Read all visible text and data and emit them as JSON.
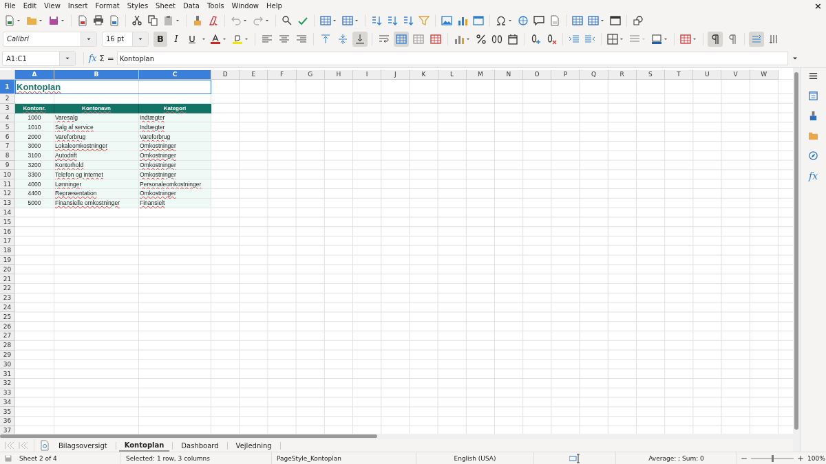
{
  "window": {
    "close": "×"
  },
  "menu": [
    "File",
    "Edit",
    "View",
    "Insert",
    "Format",
    "Styles",
    "Sheet",
    "Data",
    "Tools",
    "Window",
    "Help"
  ],
  "format_bar": {
    "font": "Calibri",
    "size": "16 pt",
    "text_style": [
      {
        "kind": "bold",
        "label": "B",
        "on": true
      },
      {
        "kind": "italic",
        "label": "I",
        "on": false
      },
      {
        "kind": "underline",
        "label": "U",
        "on": false
      }
    ],
    "horizontal_align": [
      {
        "kind": "left",
        "selected": false
      },
      {
        "kind": "center",
        "selected": false
      },
      {
        "kind": "right",
        "selected": false
      }
    ],
    "vertical_align": [
      {
        "kind": "top",
        "selected": false
      },
      {
        "kind": "middle",
        "selected": false
      },
      {
        "kind": "bottom",
        "selected": true
      }
    ],
    "merge": [
      {
        "kind": "wrap",
        "on": false
      },
      {
        "kind": "merge-center",
        "on": true
      },
      {
        "kind": "merge",
        "on": false
      },
      {
        "kind": "unmerge",
        "on": false
      }
    ],
    "direction": [
      {
        "kind": "ltr",
        "selected": true
      },
      {
        "kind": "rtl",
        "selected": false
      }
    ],
    "writing": [
      {
        "kind": "horizontal",
        "selected": true
      },
      {
        "kind": "vertical",
        "selected": false
      }
    ]
  },
  "formula_bar": {
    "name_box": "A1:C1",
    "buttons": [
      "fx",
      "Σ",
      "="
    ],
    "content": "Kontoplan"
  },
  "columns": [
    {
      "label": "A",
      "selected": true
    },
    {
      "label": "B",
      "selected": true
    },
    {
      "label": "C",
      "selected": true
    },
    {
      "label": "D",
      "selected": false
    },
    {
      "label": "E",
      "selected": false
    },
    {
      "label": "F",
      "selected": false
    },
    {
      "label": "G",
      "selected": false
    },
    {
      "label": "H",
      "selected": false
    },
    {
      "label": "I",
      "selected": false
    },
    {
      "label": "J",
      "selected": false
    },
    {
      "label": "K",
      "selected": false
    },
    {
      "label": "L",
      "selected": false
    },
    {
      "label": "M",
      "selected": false
    },
    {
      "label": "N",
      "selected": false
    },
    {
      "label": "O",
      "selected": false
    },
    {
      "label": "P",
      "selected": false
    },
    {
      "label": "Q",
      "selected": false
    },
    {
      "label": "R",
      "selected": false
    },
    {
      "label": "S",
      "selected": false
    },
    {
      "label": "T",
      "selected": false
    },
    {
      "label": "U",
      "selected": false
    },
    {
      "label": "V",
      "selected": false
    },
    {
      "label": "W",
      "selected": false
    }
  ],
  "rows": [
    {
      "label": "1",
      "selected": true,
      "kind": "title",
      "cells": [
        "Kontoplan"
      ]
    },
    {
      "label": "2",
      "selected": false
    },
    {
      "label": "3",
      "selected": false,
      "kind": "header",
      "cells": [
        "Kontonr.",
        "Kontonavn",
        "Kategori"
      ]
    },
    {
      "label": "4",
      "selected": false,
      "kind": "data",
      "cells": [
        "1000",
        "Varesalg",
        "Indtægter"
      ]
    },
    {
      "label": "5",
      "selected": false,
      "kind": "data",
      "cells": [
        "1010",
        "Salg af service",
        "Indtægter"
      ]
    },
    {
      "label": "6",
      "selected": false,
      "kind": "data",
      "cells": [
        "2000",
        "Vareforbrug",
        "Vareforbrug"
      ]
    },
    {
      "label": "7",
      "selected": false,
      "kind": "data",
      "cells": [
        "3000",
        "Lokaleomkostninger",
        "Omkostninger"
      ]
    },
    {
      "label": "8",
      "selected": false,
      "kind": "data",
      "cells": [
        "3100",
        "Autodrift",
        "Omkostninger"
      ]
    },
    {
      "label": "9",
      "selected": false,
      "kind": "data",
      "cells": [
        "3200",
        "Kontorhold",
        "Omkostninger"
      ]
    },
    {
      "label": "10",
      "selected": false,
      "kind": "data",
      "cells": [
        "3300",
        "Telefon og internet",
        "Omkostninger"
      ]
    },
    {
      "label": "11",
      "selected": false,
      "kind": "data",
      "cells": [
        "4000",
        "Lønninger",
        "Personaleomkostninger"
      ]
    },
    {
      "label": "12",
      "selected": false,
      "kind": "data",
      "cells": [
        "4400",
        "Repræsentation",
        "Omkostninger"
      ]
    },
    {
      "label": "13",
      "selected": false,
      "kind": "data",
      "cells": [
        "5000",
        "Finansielle omkostninger",
        "Finansielt"
      ]
    },
    {
      "label": "14",
      "selected": false
    },
    {
      "label": "15",
      "selected": false
    },
    {
      "label": "16",
      "selected": false
    },
    {
      "label": "17",
      "selected": false
    },
    {
      "label": "18",
      "selected": false
    },
    {
      "label": "19",
      "selected": false
    },
    {
      "label": "20",
      "selected": false
    },
    {
      "label": "21",
      "selected": false
    },
    {
      "label": "22",
      "selected": false
    },
    {
      "label": "23",
      "selected": false
    },
    {
      "label": "24",
      "selected": false
    },
    {
      "label": "25",
      "selected": false
    },
    {
      "label": "26",
      "selected": false
    },
    {
      "label": "27",
      "selected": false
    },
    {
      "label": "28",
      "selected": false
    },
    {
      "label": "29",
      "selected": false
    },
    {
      "label": "30",
      "selected": false
    },
    {
      "label": "31",
      "selected": false
    },
    {
      "label": "32",
      "selected": false
    },
    {
      "label": "33",
      "selected": false
    },
    {
      "label": "34",
      "selected": false
    },
    {
      "label": "35",
      "selected": false
    },
    {
      "label": "36",
      "selected": false
    },
    {
      "label": "37",
      "selected": false
    }
  ],
  "sidebar": [
    {
      "kind": "menu"
    },
    {
      "kind": "properties"
    },
    {
      "kind": "styles"
    },
    {
      "kind": "gallery"
    },
    {
      "kind": "navigator"
    },
    {
      "kind": "functions",
      "label": "fx"
    }
  ],
  "sheet_tabs": [
    {
      "label": "Bilagsoversigt",
      "selected": false
    },
    {
      "label": "Kontoplan",
      "selected": true
    },
    {
      "label": "Dashboard",
      "selected": false
    },
    {
      "label": "Vejledning",
      "selected": false
    }
  ],
  "status_bar": {
    "sheet": "Sheet 2 of 4",
    "selection": "Selected: 1 row, 3 columns",
    "page_style": "PageStyle_Kontoplan",
    "language": "English (USA)",
    "sum": "Average: ; Sum: 0",
    "zoom": "100%",
    "zoom_slider": {
      "level": 0.5
    }
  }
}
